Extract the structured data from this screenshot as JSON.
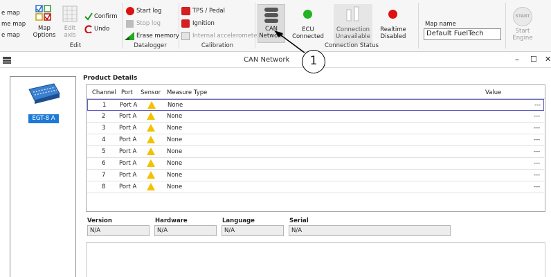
{
  "ribbon": {
    "map_items": [
      "e map",
      "me map",
      "e map"
    ],
    "map_options": "Map\nOptions",
    "edit_axis": "Edit\naxis",
    "confirm": "Confirm",
    "undo": "Undo",
    "edit_group": "Edit",
    "start_log": "Start log",
    "stop_log": "Stop log",
    "erase_memory": "Erase memory",
    "datalogger_group": "Datalogger",
    "tps_pedal": "TPS / Pedal",
    "ignition": "Ignition",
    "internal_accel": "Internal accelerometer",
    "calibration_group": "Calibration",
    "can_network": "CAN\nNetwork",
    "ecu_connected": "ECU\nConnected",
    "connection_unavailable": "Connection\nUnavailable",
    "realtime_disabled": "Realtime\nDisabled",
    "connection_status_group": "Connection Status",
    "map_name_label": "Map name",
    "map_name_value": "Default FuelTech",
    "start_badge": "START",
    "start_engine": "Start\nEngine",
    "callout_number": "1"
  },
  "colors": {
    "green": "#22b322",
    "red": "#dd1111",
    "selected_bg": "#1e7ad6",
    "warning": "#f2c200"
  },
  "window": {
    "title": "CAN Network",
    "minimize": "–",
    "maximize": "☐",
    "close": "✕"
  },
  "device": {
    "label": "EGT-8 A"
  },
  "product": {
    "title": "Product Details",
    "headers": [
      "Channel",
      "Port",
      "Sensor",
      "Measure Type",
      "Value"
    ],
    "rows": [
      {
        "channel": "1",
        "port": "Port A",
        "measure": "None",
        "value": "---"
      },
      {
        "channel": "2",
        "port": "Port A",
        "measure": "None",
        "value": "---"
      },
      {
        "channel": "3",
        "port": "Port A",
        "measure": "None",
        "value": "---"
      },
      {
        "channel": "4",
        "port": "Port A",
        "measure": "None",
        "value": "---"
      },
      {
        "channel": "5",
        "port": "Port A",
        "measure": "None",
        "value": "---"
      },
      {
        "channel": "6",
        "port": "Port A",
        "measure": "None",
        "value": "---"
      },
      {
        "channel": "7",
        "port": "Port A",
        "measure": "None",
        "value": "---"
      },
      {
        "channel": "8",
        "port": "Port A",
        "measure": "None",
        "value": "---"
      }
    ]
  },
  "info": {
    "version_label": "Version",
    "version_value": "N/A",
    "hardware_label": "Hardware",
    "hardware_value": "N/A",
    "language_label": "Language",
    "language_value": "N/A",
    "serial_label": "Serial",
    "serial_value": "N/A"
  }
}
